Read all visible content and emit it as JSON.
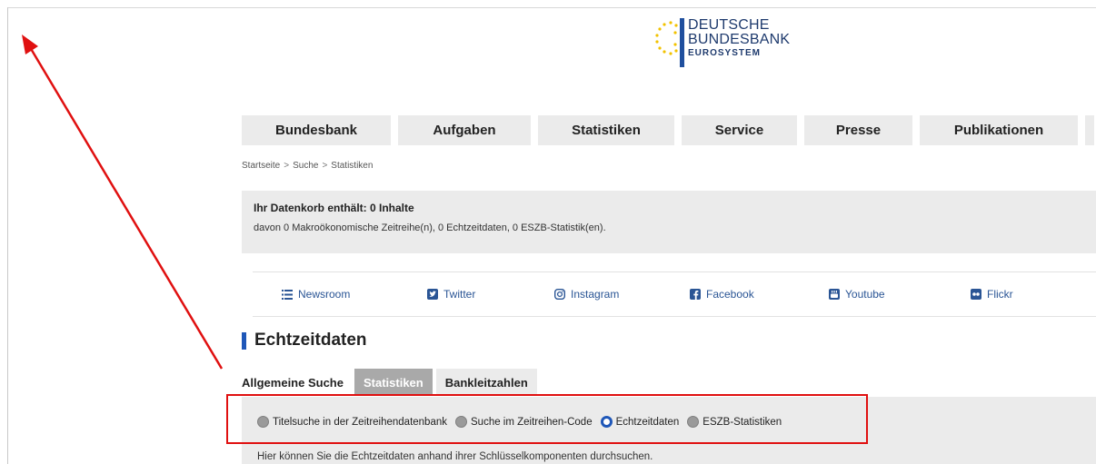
{
  "logo": {
    "line1": "DEUTSCHE",
    "line2": "BUNDESBANK",
    "line3": "EUROSYSTEM"
  },
  "nav": {
    "items": [
      {
        "label": "Bundesbank"
      },
      {
        "label": "Aufgaben"
      },
      {
        "label": "Statistiken"
      },
      {
        "label": "Service"
      },
      {
        "label": "Presse"
      },
      {
        "label": "Publikationen"
      }
    ]
  },
  "breadcrumb": {
    "items": [
      "Startseite",
      "Suche",
      "Statistiken"
    ],
    "separator": ">"
  },
  "basket": {
    "title": "Ihr Datenkorb enthält: 0 Inhalte",
    "detail": "davon 0 Makroökonomische Zeitreihe(n), 0 Echtzeitdaten, 0 ESZB-Statistik(en)."
  },
  "social": [
    {
      "label": "Newsroom",
      "icon": "list-icon"
    },
    {
      "label": "Twitter",
      "icon": "twitter-icon"
    },
    {
      "label": "Instagram",
      "icon": "instagram-icon"
    },
    {
      "label": "Facebook",
      "icon": "facebook-icon"
    },
    {
      "label": "Youtube",
      "icon": "youtube-icon"
    },
    {
      "label": "Flickr",
      "icon": "flickr-icon"
    }
  ],
  "section": {
    "title": "Echtzeitdaten"
  },
  "tabs": [
    {
      "label": "Allgemeine Suche",
      "active": false
    },
    {
      "label": "Statistiken",
      "active": true
    },
    {
      "label": "Bankleitzahlen",
      "active": false
    }
  ],
  "search_type": {
    "options": [
      {
        "label": "Titelsuche in der Zeitreihendatenbank",
        "checked": false
      },
      {
        "label": "Suche im Zeitreihen-Code",
        "checked": false
      },
      {
        "label": "Echtzeitdaten",
        "checked": true
      },
      {
        "label": "ESZB-Statistiken",
        "checked": false
      }
    ],
    "description": "Hier können Sie die Echtzeitdaten anhand ihrer Schlüsselkomponenten durchsuchen."
  },
  "colors": {
    "brand_blue": "#1f57b8",
    "logo_blue": "#1e3a6d",
    "link_blue": "#2a5595",
    "panel_gray": "#ebebeb",
    "active_tab": "#a9a9a9",
    "annotation_red": "#e01010"
  }
}
